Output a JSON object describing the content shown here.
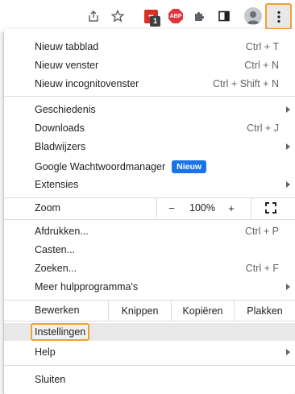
{
  "toolbar": {
    "icons": [
      "share-icon",
      "bookmark-star-icon",
      "extension-badge-icon",
      "adblock-plus-icon",
      "extensions-puzzle-icon",
      "side-panel-icon",
      "profile-icon",
      "more-menu-icon"
    ],
    "ext_badge": "1",
    "abp_text": "ABP",
    "ext_red_text": "•••"
  },
  "menu": {
    "group1": [
      {
        "label": "Nieuw tabblad",
        "shortcut": "Ctrl + T"
      },
      {
        "label": "Nieuw venster",
        "shortcut": "Ctrl + N"
      },
      {
        "label": "Nieuw incognitovenster",
        "shortcut": "Ctrl + Shift + N"
      }
    ],
    "group2": [
      {
        "label": "Geschiedenis"
      },
      {
        "label": "Downloads",
        "shortcut": "Ctrl + J"
      },
      {
        "label": "Bladwijzers"
      },
      {
        "label": "Google Wachtwoordmanager",
        "badge": "Nieuw"
      },
      {
        "label": "Extensies"
      }
    ],
    "zoom": {
      "label": "Zoom",
      "minus": "−",
      "value": "100%",
      "plus": "+"
    },
    "group3": [
      {
        "label": "Afdrukken...",
        "shortcut": "Ctrl + P"
      },
      {
        "label": "Casten..."
      },
      {
        "label": "Zoeken...",
        "shortcut": "Ctrl + F"
      },
      {
        "label": "Meer hulpprogramma's"
      }
    ],
    "edit": {
      "label": "Bewerken",
      "cut": "Knippen",
      "copy": "Kopiëren",
      "paste": "Plakken"
    },
    "group4": [
      {
        "label": "Instellingen"
      },
      {
        "label": "Help"
      }
    ],
    "exit": {
      "label": "Sluiten"
    }
  },
  "colors": {
    "accent_highlight": "#f0a030",
    "new_badge": "#1a73e8"
  }
}
